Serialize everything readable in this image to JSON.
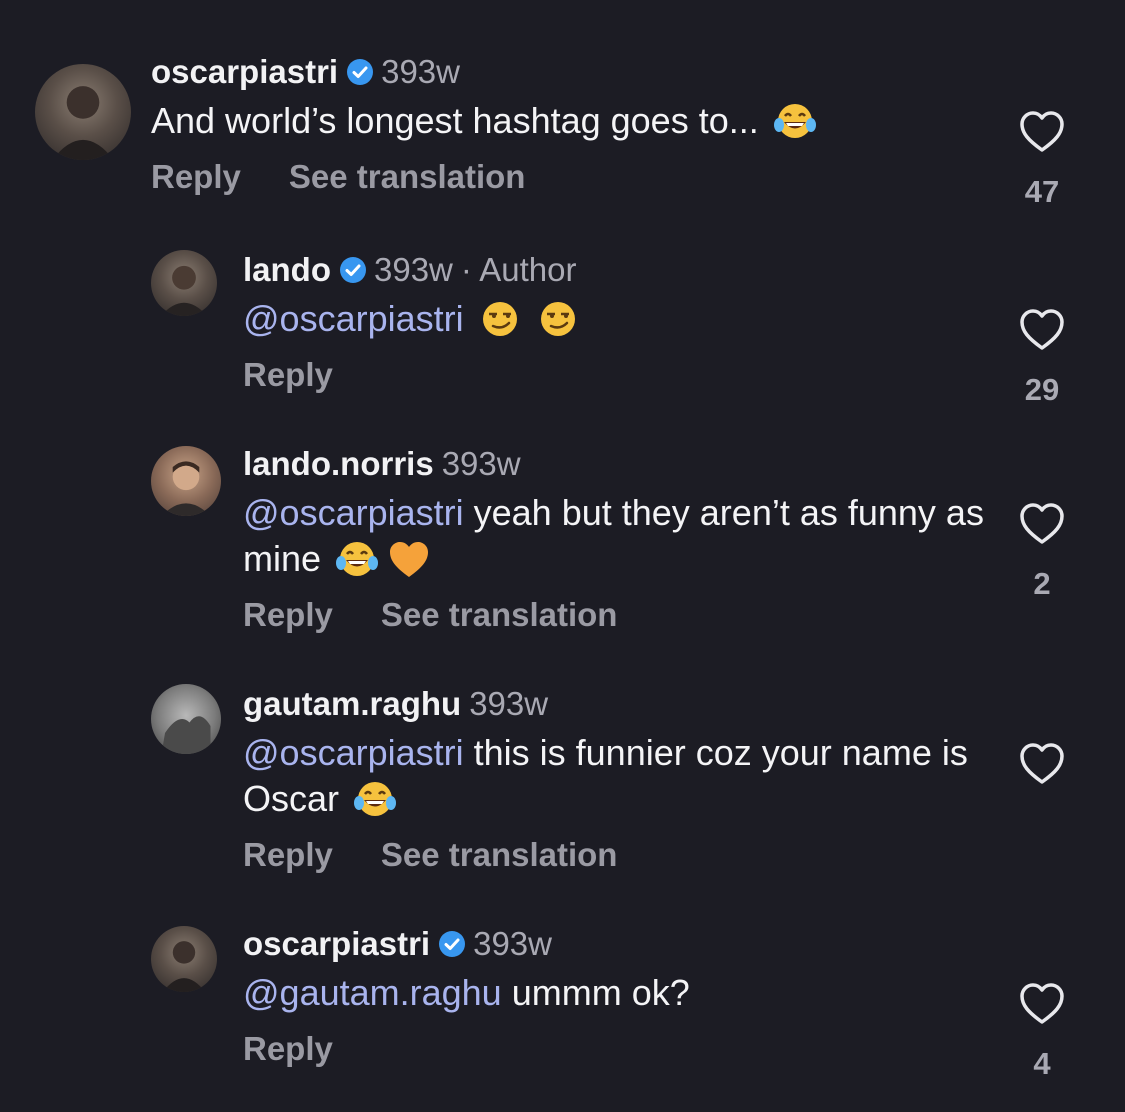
{
  "comments": [
    {
      "username": "oscarpiastri",
      "verified": true,
      "time": "393w",
      "author": "",
      "mention": "",
      "text": "And world’s longest hashtag goes to...",
      "emojis": [
        "tears-of-joy"
      ],
      "actions": [
        "Reply",
        "See translation"
      ],
      "likes": "47"
    },
    {
      "username": "lando",
      "verified": true,
      "time": "393w",
      "author": "· Author",
      "mention": "@oscarpiastri",
      "text": "",
      "emojis": [
        "smirk",
        "smirk"
      ],
      "actions": [
        "Reply"
      ],
      "likes": "29"
    },
    {
      "username": "lando.norris",
      "verified": false,
      "time": "393w",
      "author": "",
      "mention": "@oscarpiastri",
      "text": "yeah but they aren’t as funny as mine",
      "emojis": [
        "tears-of-joy",
        "orange-heart"
      ],
      "actions": [
        "Reply",
        "See translation"
      ],
      "likes": "2"
    },
    {
      "username": "gautam.raghu",
      "verified": false,
      "time": "393w",
      "author": "",
      "mention": "@oscarpiastri",
      "text": "this is funnier coz your name is Oscar",
      "emojis": [
        "tears-of-joy"
      ],
      "actions": [
        "Reply",
        "See translation"
      ],
      "likes": ""
    },
    {
      "username": "oscarpiastri",
      "verified": true,
      "time": "393w",
      "author": "",
      "mention": "@gautam.raghu",
      "text": "ummm ok?",
      "emojis": [],
      "actions": [
        "Reply"
      ],
      "likes": "4"
    }
  ],
  "colors": {
    "background": "#1c1c24",
    "mention": "#a9b4ee",
    "verified_badge": "#3897f0",
    "muted": "#9a9aa3"
  }
}
